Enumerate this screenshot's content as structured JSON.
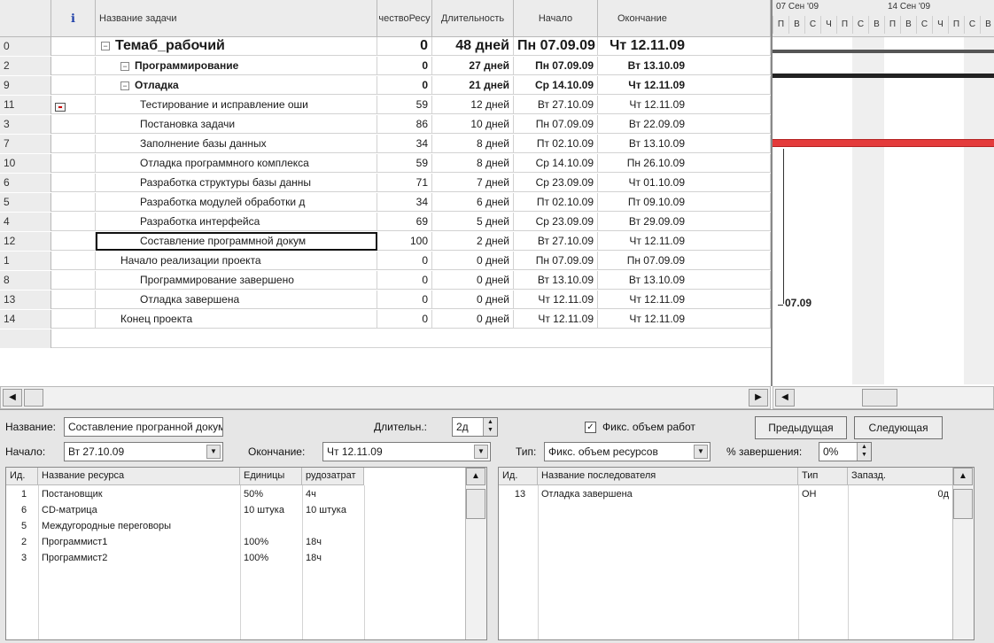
{
  "task_table": {
    "headers": {
      "id": "",
      "indicators": "ℹ",
      "name": "Название задачи",
      "count": "чествоРесу",
      "duration": "Длительность",
      "start": "Начало",
      "end": "Окончание"
    },
    "rows": [
      {
        "id": "0",
        "name": "Темаб_рабочий",
        "count": "0",
        "duration": "48 дней",
        "start": "Пн 07.09.09",
        "end": "Чт 12.11.09"
      },
      {
        "id": "2",
        "name": "Программирование",
        "count": "0",
        "duration": "27 дней",
        "start": "Пн 07.09.09",
        "end": "Вт 13.10.09"
      },
      {
        "id": "9",
        "name": "Отладка",
        "count": "0",
        "duration": "21 дней",
        "start": "Ср 14.10.09",
        "end": "Чт 12.11.09"
      },
      {
        "id": "11",
        "name": "Тестирование и исправление оши",
        "count": "59",
        "duration": "12 дней",
        "start": "Вт 27.10.09",
        "end": "Чт 12.11.09"
      },
      {
        "id": "3",
        "name": "Постановка задачи",
        "count": "86",
        "duration": "10 дней",
        "start": "Пн 07.09.09",
        "end": "Вт 22.09.09"
      },
      {
        "id": "7",
        "name": "Заполнение базы данных",
        "count": "34",
        "duration": "8 дней",
        "start": "Пт 02.10.09",
        "end": "Вт 13.10.09"
      },
      {
        "id": "10",
        "name": "Отладка программного комплекса",
        "count": "59",
        "duration": "8 дней",
        "start": "Ср 14.10.09",
        "end": "Пн 26.10.09"
      },
      {
        "id": "6",
        "name": "Разработка структуры базы данны",
        "count": "71",
        "duration": "7 дней",
        "start": "Ср 23.09.09",
        "end": "Чт 01.10.09"
      },
      {
        "id": "5",
        "name": "Разработка модулей обработки д",
        "count": "34",
        "duration": "6 дней",
        "start": "Пт 02.10.09",
        "end": "Пт 09.10.09"
      },
      {
        "id": "4",
        "name": "Разработка интерфейса",
        "count": "69",
        "duration": "5 дней",
        "start": "Ср 23.09.09",
        "end": "Вт 29.09.09"
      },
      {
        "id": "12",
        "name": "Составление программной докум",
        "count": "100",
        "duration": "2 дней",
        "start": "Вт 27.10.09",
        "end": "Чт 12.11.09"
      },
      {
        "id": "1",
        "name": "Начало реализации проекта",
        "count": "0",
        "duration": "0 дней",
        "start": "Пн 07.09.09",
        "end": "Пн 07.09.09"
      },
      {
        "id": "8",
        "name": "Программирование завершено",
        "count": "0",
        "duration": "0 дней",
        "start": "Вт 13.10.09",
        "end": "Вт 13.10.09"
      },
      {
        "id": "13",
        "name": "Отладка завершена",
        "count": "0",
        "duration": "0 дней",
        "start": "Чт 12.11.09",
        "end": "Чт 12.11.09"
      },
      {
        "id": "14",
        "name": "Конец проекта",
        "count": "0",
        "duration": "0 дней",
        "start": "Чт 12.11.09",
        "end": "Чт 12.11.09"
      }
    ]
  },
  "gantt": {
    "week1": "07 Сен '09",
    "week2": "14 Сен '09",
    "days": [
      "П",
      "В",
      "С",
      "Ч",
      "П",
      "С",
      "В",
      "П",
      "В",
      "С",
      "Ч",
      "П",
      "С",
      "В"
    ],
    "milestone_label": "07.09",
    "bar_color": "#e43b3b"
  },
  "scroll": {
    "left_arrow": "◀",
    "right_arrow": "▶"
  },
  "form": {
    "name_label": "Название:",
    "name_value": "Составление програнной документ",
    "duration_label": "Длительн.:",
    "duration_value": "2д",
    "fixed_work_label": "Фикс. объем работ",
    "fixed_work_checked": "✓",
    "prev_button": "Предыдущая",
    "next_button": "Следующая",
    "start_label": "Начало:",
    "start_value": "Вт 27.10.09",
    "end_label": "Окончание:",
    "end_value": "Чт 12.11.09",
    "type_label": "Тип:",
    "type_value": "Фикс. объем ресурсов",
    "complete_label": "% завершения:",
    "complete_value": "0%"
  },
  "resources": {
    "headers": {
      "id": "Ид.",
      "name": "Название ресурса",
      "units": "Единицы",
      "work": "рудозатрат"
    },
    "rows": [
      {
        "id": "1",
        "name": "Постановщик",
        "units": "50%",
        "work": "4ч"
      },
      {
        "id": "6",
        "name": "CD-матрица",
        "units": "10 штука",
        "work": "10 штука"
      },
      {
        "id": "5",
        "name": "Междугородные переговоры",
        "units": "",
        "work": ""
      },
      {
        "id": "2",
        "name": "Программист1",
        "units": "100%",
        "work": "18ч"
      },
      {
        "id": "3",
        "name": "Программист2",
        "units": "100%",
        "work": "18ч"
      }
    ]
  },
  "successors": {
    "headers": {
      "id": "Ид.",
      "name": "Название последователя",
      "type": "Тип",
      "lag": "Запазд."
    },
    "rows": [
      {
        "id": "13",
        "name": "Отладка завершена",
        "type": "ОН",
        "lag": "0д"
      }
    ]
  }
}
